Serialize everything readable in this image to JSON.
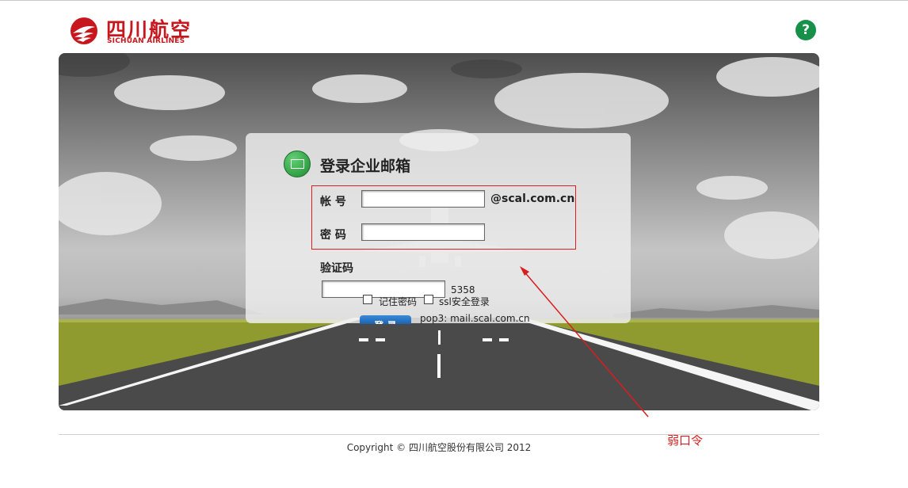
{
  "brand": {
    "logo_cn": "四川航空",
    "logo_en": "SICHUAN AIRLINES",
    "help_glyph": "?",
    "accent_red": "#c8161d",
    "help_green": "#17904a"
  },
  "login": {
    "title": "登录企业邮箱",
    "account_label": "帐  号",
    "account_value": "",
    "domain_suffix": "@scal.com.cn",
    "password_label": "密  码",
    "password_value": "",
    "captcha_label": "验证码",
    "captcha_value": "",
    "captcha_code": "5358",
    "remember_password": {
      "label": "记住密码",
      "checked": false
    },
    "ssl_login": {
      "label": "ssl安全登录",
      "checked": false
    },
    "pop3_text": "pop3: mail.scal.com.cn",
    "login_button": "登 录"
  },
  "footer": {
    "copyright": "Copyright © 四川航空股份有限公司 2012"
  },
  "annotation": {
    "text": "弱口令",
    "color": "#d81e1e"
  }
}
